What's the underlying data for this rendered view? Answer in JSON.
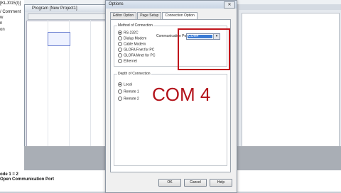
{
  "background": {
    "left_panel": [
      "[KLJ015(I)]",
      "/ Comment",
      "w",
      "n",
      "on"
    ],
    "program_window_title": "Program [New Project1]",
    "status_line1": "ode 1 = 2",
    "status_line2": "Open Communication Port"
  },
  "dialog": {
    "title": "Options",
    "close_symbol": "✕",
    "tabs": [
      "Editor Option",
      "Page Setup",
      "Connection Option"
    ],
    "method_group": {
      "label": "Method of Connection",
      "options": [
        "RS-232C",
        "Dialup Modem",
        "Cable Modem",
        "GLOFA Fnet for PC",
        "GLOFA Mnet for PC",
        "Ethernet"
      ]
    },
    "comm_port_label": "Communication Port",
    "comm_port_value": "COM4",
    "dropdown_arrow": "▾",
    "depth_group": {
      "label": "Depth of Connection",
      "options": [
        "Local",
        "Remote 1",
        "Remote 2"
      ]
    },
    "buttons": {
      "ok": "OK",
      "cancel": "Cancel",
      "help": "Help"
    }
  },
  "annotation": {
    "text": "COM 4",
    "color": "#b3121a"
  }
}
